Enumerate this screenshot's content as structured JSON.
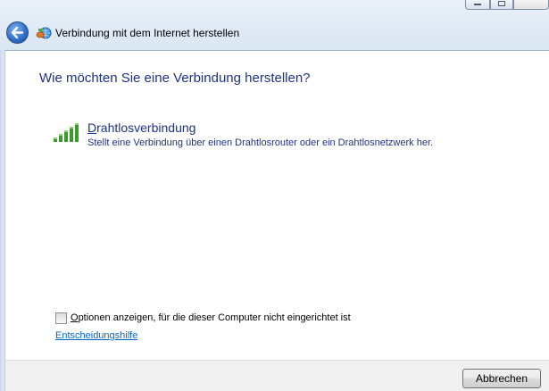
{
  "window": {
    "title": "Verbindung mit dem Internet herstellen",
    "back_icon": "back-arrow-icon",
    "app_icon": "network-globe-icon"
  },
  "content": {
    "heading": "Wie möchten Sie eine Verbindung herstellen?",
    "options": [
      {
        "icon": "wireless-signal-icon",
        "title_first": "D",
        "title_rest": "rahtlosverbindung",
        "description": "Stellt eine Verbindung über einen Drahtlosrouter oder ein Drahtlosnetzwerk her."
      }
    ],
    "checkbox": {
      "checked": false,
      "label_first": "O",
      "label_rest": "ptionen anzeigen, für die dieser Computer nicht eingerichtet ist"
    },
    "help_link": "Entscheidungshilfe"
  },
  "footer": {
    "cancel_label": "Abbrechen"
  },
  "colors": {
    "heading": "#1e3287",
    "link": "#0066cc",
    "signal_green": "#3c9a2e"
  }
}
